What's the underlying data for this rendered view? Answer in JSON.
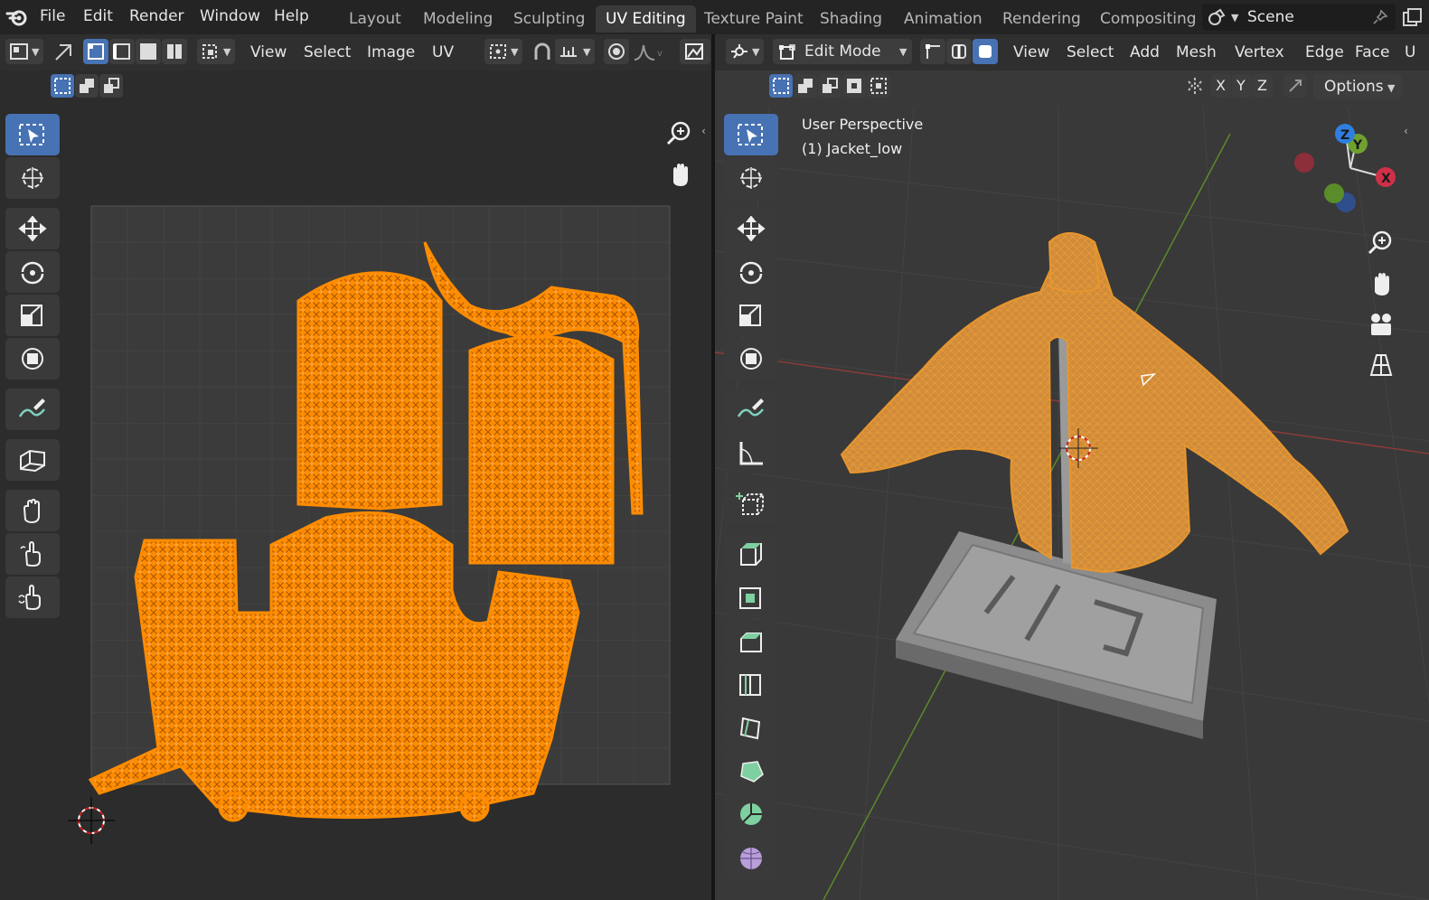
{
  "menu": {
    "items": [
      "File",
      "Edit",
      "Render",
      "Window",
      "Help"
    ]
  },
  "workspaces": {
    "tabs": [
      "Layout",
      "Modeling",
      "Sculpting",
      "UV Editing",
      "Texture Paint",
      "Shading",
      "Animation",
      "Rendering",
      "Compositing"
    ],
    "active": "UV Editing"
  },
  "scene": {
    "label": "Scene"
  },
  "uv_editor": {
    "menus": [
      "View",
      "Select",
      "Image",
      "UV"
    ]
  },
  "viewport": {
    "mode": "Edit Mode",
    "menus": [
      "View",
      "Select",
      "Add",
      "Mesh",
      "Vertex",
      "Edge",
      "Face",
      "U"
    ],
    "axes": [
      "X",
      "Y",
      "Z"
    ],
    "options_label": "Options",
    "overlay_title": "User Perspective",
    "overlay_object": "(1) Jacket_low",
    "gizmo_labels": {
      "x": "X",
      "y": "Y",
      "z": "Z"
    }
  },
  "colors": {
    "accent": "#4772b3",
    "selection_orange": "#ff8c00",
    "grid_x": "#b23c3c",
    "grid_y": "#6c9e2e"
  }
}
